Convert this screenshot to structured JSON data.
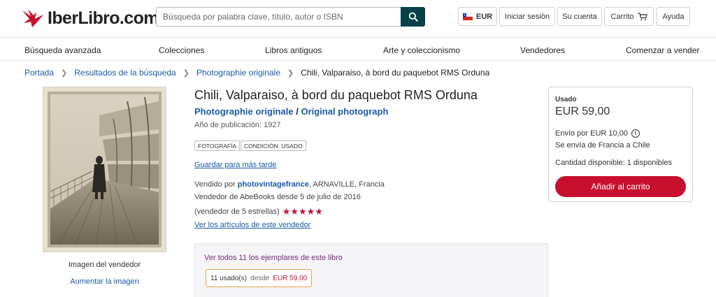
{
  "header": {
    "logo_text": "IberLibro.com",
    "search_placeholder": "Búsqueda por palabra clave, título, autor o ISBN",
    "currency": "EUR",
    "sign_in": "Iniciar sesión",
    "account": "Su cuenta",
    "cart": "Carrito",
    "help": "Ayuda"
  },
  "nav": {
    "items": [
      "Búsqueda avanzada",
      "Colecciones",
      "Libros antiguos",
      "Arte y coleccionismo",
      "Vendedores",
      "Comenzar a vender"
    ]
  },
  "breadcrumb": {
    "items": [
      "Portada",
      "Resultados de la búsqueda",
      "Photographie originale"
    ],
    "current": "Chili, Valparaiso, à bord du paquebot RMS Orduna"
  },
  "image": {
    "caption": "Imagen del vendedor",
    "enlarge": "Aumentar la imagen"
  },
  "product": {
    "title": "Chili, Valparaiso, à bord du paquebot RMS Orduna",
    "subtitle_1": "Photographie originale",
    "subtitle_sep": "/",
    "subtitle_2": "Original photograph",
    "pub_year": "Año de publicación: 1927",
    "tags": [
      "FOTOGRAFÍA",
      "CONDICIÓN: USADO"
    ],
    "save_later": "Guardar para más tarde"
  },
  "seller": {
    "sold_by": "Vendido por",
    "name": "photovintagefrance",
    "location": ", ARNAVILLE, Francia",
    "since": "Vendedor de AbeBooks desde 5 de julio de 2016",
    "rating_text": "(vendedor de 5 estrellas)",
    "stars": "★★★★★",
    "see_items": "Ver los artículos de este vendedor"
  },
  "copies": {
    "link": "Ver todos 11 los ejemplares de este libro",
    "count": "11 usado(s)",
    "from": "desde",
    "price": "EUR 59,00"
  },
  "price_card": {
    "condition": "Usado",
    "price": "EUR 59,00",
    "shipping": "Envío por EUR 10,00",
    "ships_from": "Se envía de Francia a Chile",
    "quantity": "Cantidad disponible: 1 disponibles",
    "add_to_cart": "Añadir al carrito"
  },
  "colors": {
    "brand_red": "#c8102e",
    "search_button": "#064049",
    "link_blue": "#1b5aa8",
    "stars": "#c0143c"
  },
  "icons": [
    "logo-bird-icon",
    "search-icon",
    "chile-flag-icon",
    "cart-icon",
    "chevron-right-icon",
    "info-icon"
  ]
}
